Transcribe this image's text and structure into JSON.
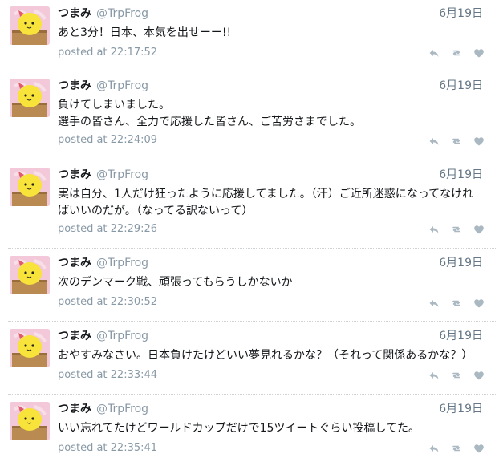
{
  "tweets": [
    {
      "display_name": "つまみ",
      "screen_name": "@TrpFrog",
      "date": "6月19日",
      "text_lines": [
        "あと3分！日本、本気を出せーー!!"
      ],
      "posted": "posted at 22:17:52"
    },
    {
      "display_name": "つまみ",
      "screen_name": "@TrpFrog",
      "date": "6月19日",
      "text_lines": [
        "負けてしまいました。",
        "選手の皆さん、全力で応援した皆さん、ご苦労さまでした。"
      ],
      "posted": "posted at 22:24:09"
    },
    {
      "display_name": "つまみ",
      "screen_name": "@TrpFrog",
      "date": "6月19日",
      "text_lines": [
        "実は自分、1人だけ狂ったように応援してました。（汗）ご近所迷惑になってなけれ",
        "ばいいのだが。（なってる訳ないって）"
      ],
      "posted": "posted at 22:29:26"
    },
    {
      "display_name": "つまみ",
      "screen_name": "@TrpFrog",
      "date": "6月19日",
      "text_lines": [
        "次のデンマーク戦、頑張ってもらうしかないか"
      ],
      "posted": "posted at 22:30:52"
    },
    {
      "display_name": "つまみ",
      "screen_name": "@TrpFrog",
      "date": "6月19日",
      "text_lines": [
        "おやすみなさい。日本負けたけどいい夢見れるかな？（それって関係あるかな？）"
      ],
      "posted": "posted at 22:33:44"
    },
    {
      "display_name": "つまみ",
      "screen_name": "@TrpFrog",
      "date": "6月19日",
      "text_lines": [
        "いい忘れてたけどワールドカップだけで15ツイートぐらい投稿してた。"
      ],
      "posted": "posted at 22:35:41"
    }
  ],
  "icons": {
    "reply": "reply-icon",
    "retweet": "retweet-icon",
    "like": "heart-icon",
    "avatar": "avatar-image"
  },
  "colors": {
    "secondary_text": "#8899a6",
    "action_icons": "#aab8c2",
    "divider": "#cfd3d6"
  }
}
